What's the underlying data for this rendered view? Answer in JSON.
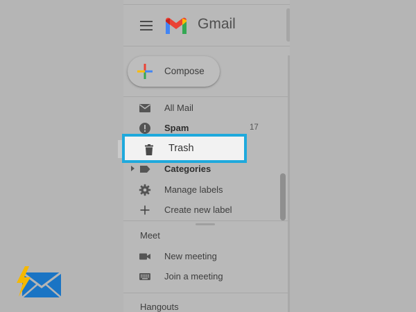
{
  "header": {
    "app_name": "Gmail",
    "menu_icon": "hamburger-menu-icon",
    "logo_icon": "gmail-logo-icon"
  },
  "compose": {
    "label": "Compose",
    "icon": "compose-plus-icon"
  },
  "nav": {
    "all_mail": {
      "label": "All Mail",
      "icon": "mail-envelope-icon"
    },
    "spam": {
      "label": "Spam",
      "count": "17",
      "icon": "spam-alert-icon"
    },
    "trash": {
      "label": "Trash",
      "icon": "trash-icon"
    },
    "categories": {
      "label": "Categories",
      "icon": "label-tag-icon"
    },
    "manage_labels": {
      "label": "Manage labels",
      "icon": "gear-icon"
    },
    "create_label": {
      "label": "Create new label",
      "icon": "plus-icon"
    }
  },
  "meet": {
    "title": "Meet",
    "new_meeting": {
      "label": "New meeting",
      "icon": "video-camera-icon"
    },
    "join_meeting": {
      "label": "Join a meeting",
      "icon": "keyboard-icon"
    }
  },
  "hangouts": {
    "title": "Hangouts"
  },
  "colors": {
    "highlight_border": "#1fa9dc",
    "gmail_red": "#ea4335",
    "gmail_blue": "#4285f4",
    "gmail_green": "#34a853",
    "gmail_yellow": "#fbbc04"
  }
}
